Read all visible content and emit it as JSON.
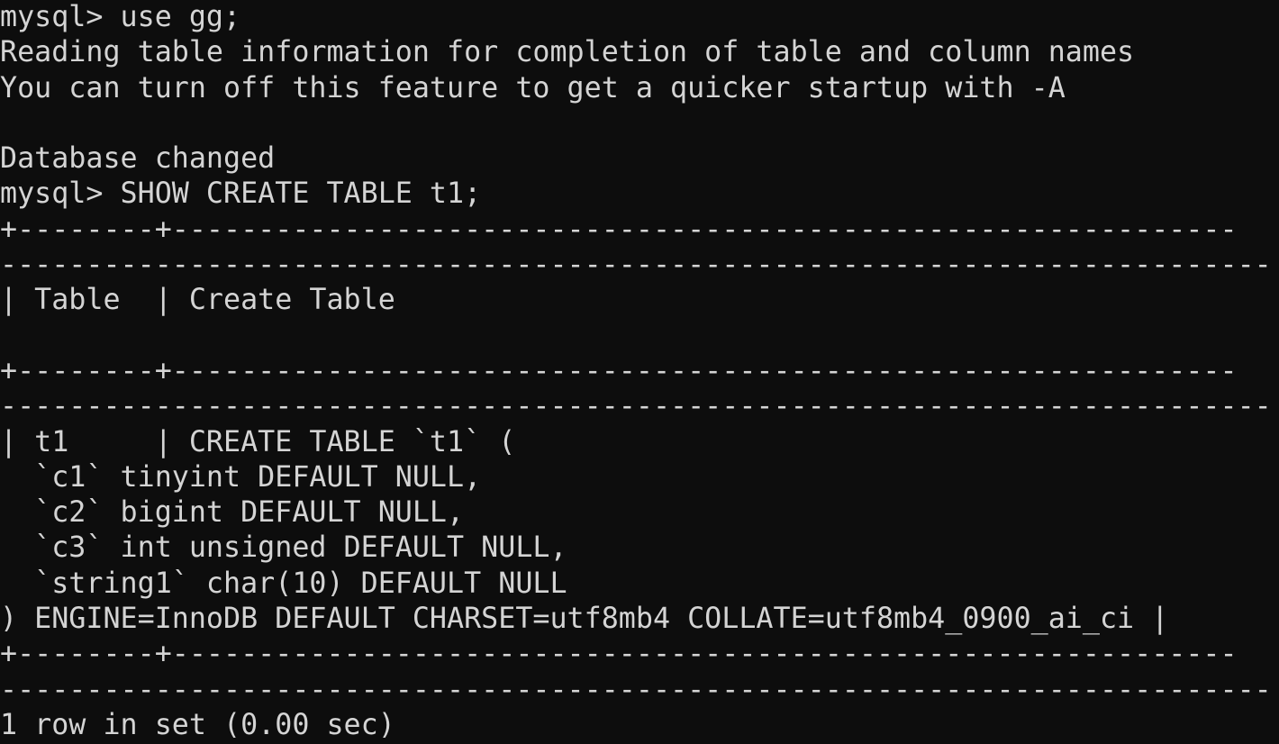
{
  "terminal": {
    "app": "mysql-cli",
    "colors": {
      "background": "#0d0d0d",
      "foreground": "#d4d4d4"
    },
    "prompt": "mysql>",
    "columns": 74,
    "lines": [
      {
        "name": "command-use-database",
        "text": "mysql> use gg;"
      },
      {
        "name": "output-reading-table-information",
        "text": "Reading table information for completion of table and column names"
      },
      {
        "name": "output-turn-off-feature",
        "text": "You can turn off this feature to get a quicker startup with -A"
      },
      {
        "name": "blank-line",
        "text": ""
      },
      {
        "name": "output-database-changed",
        "text": "Database changed"
      },
      {
        "name": "command-show-create-table",
        "text": "mysql> SHOW CREATE TABLE t1;"
      },
      {
        "name": "table-border-top",
        "text": "+--------+--------------------------------------------------------------"
      },
      {
        "name": "table-border-top-wrap",
        "text": "--------------------------------------------------------------------------"
      },
      {
        "name": "table-header-row",
        "text": "| Table  | Create Table"
      },
      {
        "name": "blank-line",
        "text": ""
      },
      {
        "name": "table-border-middle",
        "text": "+--------+--------------------------------------------------------------"
      },
      {
        "name": "table-border-middle-wrap",
        "text": "--------------------------------------------------------------------------"
      },
      {
        "name": "table-row-create-statement",
        "text": "| t1     | CREATE TABLE `t1` ("
      },
      {
        "name": "column-definition-c1",
        "text": "  `c1` tinyint DEFAULT NULL,"
      },
      {
        "name": "column-definition-c2",
        "text": "  `c2` bigint DEFAULT NULL,"
      },
      {
        "name": "column-definition-c3",
        "text": "  `c3` int unsigned DEFAULT NULL,"
      },
      {
        "name": "column-definition-string1",
        "text": "  `string1` char(10) DEFAULT NULL"
      },
      {
        "name": "table-options-line",
        "text": ") ENGINE=InnoDB DEFAULT CHARSET=utf8mb4 COLLATE=utf8mb4_0900_ai_ci |"
      },
      {
        "name": "table-border-bottom",
        "text": "+--------+--------------------------------------------------------------"
      },
      {
        "name": "table-border-bottom-wrap",
        "text": "--------------------------------------------------------------------------"
      },
      {
        "name": "output-row-count",
        "text": "1 row in set (0.00 sec)"
      }
    ]
  }
}
